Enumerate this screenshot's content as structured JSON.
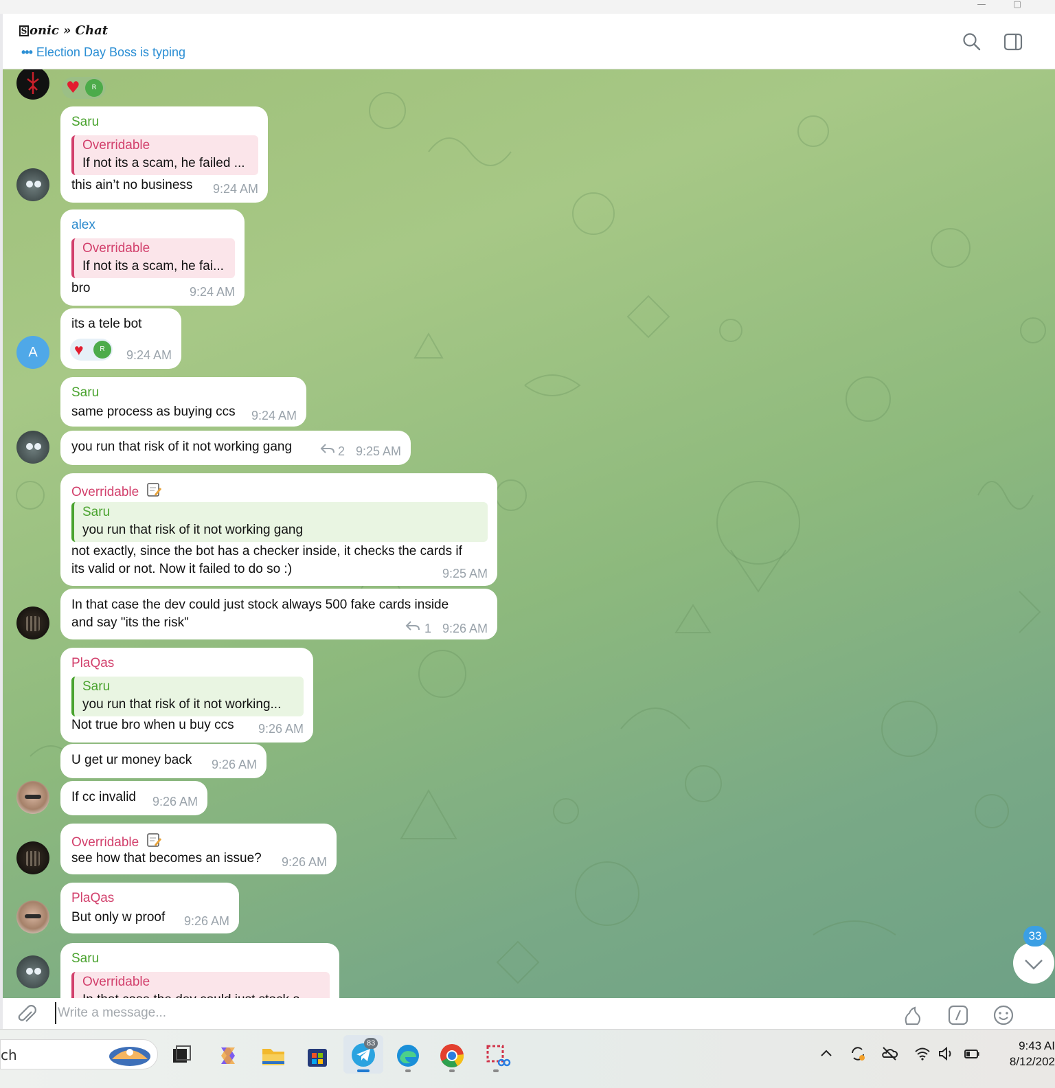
{
  "header": {
    "title_box": "S",
    "title": "onic » Chat",
    "typing_text": "Election Day Boss is typing"
  },
  "messages": [
    {
      "name": "Saru",
      "reply_name": "Overridable",
      "reply_text": "If not its a scam, he failed ...",
      "text": "this ain’t no business",
      "time": "9:24 AM"
    },
    {
      "name": "alex",
      "reply_name": "Overridable",
      "reply_text": "If not its a scam, he fai...",
      "text": "bro",
      "time": "9:24 AM"
    },
    {
      "text": "its a tele bot",
      "time": "9:24 AM",
      "reaction_badge": "R"
    },
    {
      "name": "Saru",
      "text": "same process as buying ccs",
      "time": "9:24 AM"
    },
    {
      "text": "you run that risk of it not working gang",
      "replies": "2",
      "time": "9:25 AM"
    },
    {
      "name": "Overridable",
      "reply_name": "Saru",
      "reply_text": "you run that risk of it not working gang",
      "text": "not exactly, since the bot has a checker inside, it checks the cards if\nits valid or not. Now it failed to do so :)",
      "time": "9:25 AM"
    },
    {
      "text": "In that case the dev could just stock always 500 fake cards inside\nand say \"its the risk\"",
      "replies": "1",
      "time": "9:26 AM"
    },
    {
      "name": "PlaQas",
      "reply_name": "Saru",
      "reply_text": "you run that risk of it not working...",
      "text": "Not true bro when u buy ccs",
      "time": "9:26 AM"
    },
    {
      "text": "U get ur money back",
      "time": "9:26 AM"
    },
    {
      "text": "If cc invalid",
      "time": "9:26 AM"
    },
    {
      "name": "Overridable",
      "text": "see how that becomes an issue?",
      "time": "9:26 AM"
    },
    {
      "name": "PlaQas",
      "text": "But only w proof",
      "time": "9:26 AM"
    },
    {
      "name": "Saru",
      "reply_name": "Overridable",
      "reply_text": "In that case the dev could just stock a..."
    }
  ],
  "top_reaction_badge": "R",
  "alex_avatar_letter": "A",
  "unread_count": "33",
  "composer": {
    "placeholder": "Write a message..."
  },
  "taskbar": {
    "search_text": "ch",
    "telegram_badge": "83",
    "time": "9:43 AI",
    "date": "8/12/202"
  },
  "icons": [
    "search-icon",
    "sidebar-toggle-icon",
    "attach-icon",
    "sticker-icon",
    "bot-command-icon",
    "emoji-icon",
    "chevron-down-icon",
    "reply-icon",
    "heart-icon"
  ]
}
